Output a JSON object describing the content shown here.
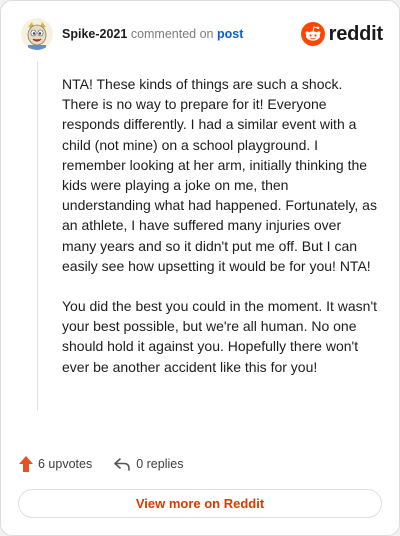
{
  "comment": {
    "username": "Spike-2021",
    "action_text": "commented on",
    "post_link_label": "post",
    "brand": "reddit",
    "paragraphs": [
      "NTA! These kinds of things are such a shock. There is no way to prepare for it! Everyone responds differently. I had a similar event with a child (not mine) on a school playground. I remember looking at her arm, initially thinking the kids were playing a joke on me, then understanding what had happened. Fortunately, as an athlete, I have suffered many injuries over many years and so it didn't put me off. But I can easily see how upsetting it would be for you! NTA!",
      "You did the best you could in the moment. It wasn't your best possible, but we're all human. No one should hold it against you. Hopefully there won't ever be another accident like this for you!"
    ],
    "upvotes_label": "6 upvotes",
    "replies_label": "0 replies"
  },
  "footer": {
    "view_more_label": "View more on Reddit"
  },
  "icons": {
    "upvote": "upvote-arrow-icon",
    "reply": "reply-arrow-icon",
    "brand": "reddit-snoo-icon"
  },
  "colors": {
    "brand_orange": "#ff4500",
    "upvote_orange": "#e8501f",
    "link_blue": "#0b5bd3",
    "view_more_text": "#d93a00"
  }
}
